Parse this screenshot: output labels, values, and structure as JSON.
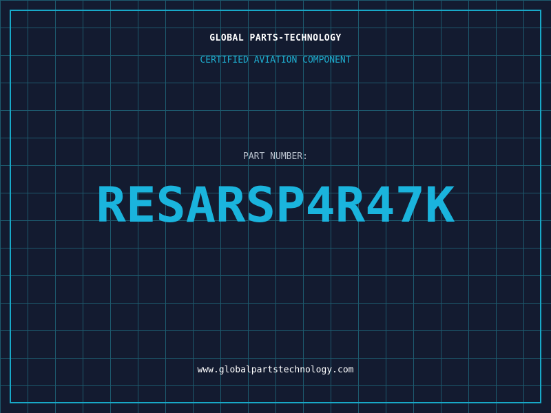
{
  "company_name": "GLOBAL PARTS-TECHNOLOGY",
  "subtitle": "CERTIFIED AVIATION COMPONENT",
  "part_number_label": "PART NUMBER:",
  "part_number": "RESARSP4R47K",
  "website": "www.globalpartstechnology.com",
  "colors": {
    "background": "#131b30",
    "grid": "#1d5a6e",
    "frame": "#18a9c8",
    "accent": "#1ab4dd"
  }
}
